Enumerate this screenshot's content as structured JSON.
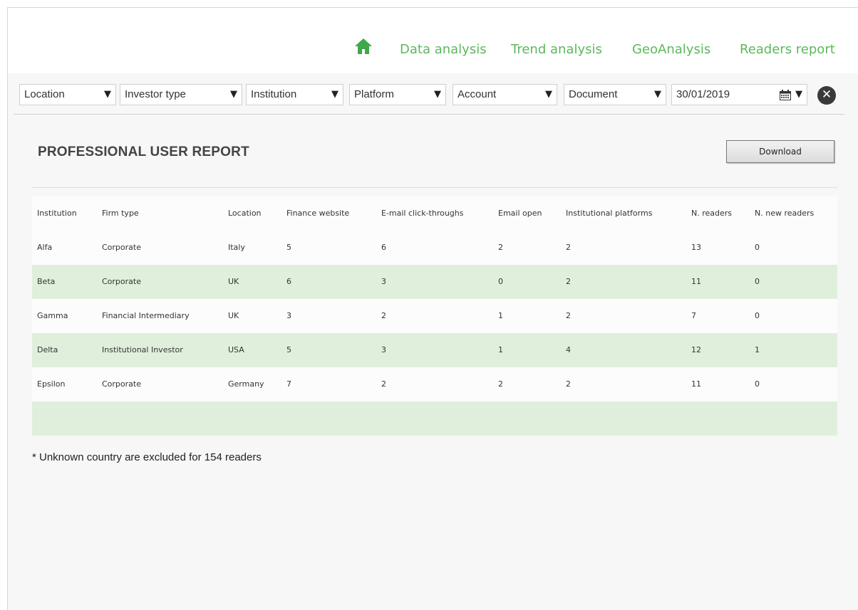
{
  "nav": {
    "items": [
      {
        "label": "Data analysis"
      },
      {
        "label": "Trend analysis"
      },
      {
        "label": "GeoAnalysis"
      },
      {
        "label": "Readers report"
      }
    ],
    "home_icon": "home-icon",
    "accent_color": "#5cb85c"
  },
  "filters": {
    "location": "Location",
    "investor_type": "Investor type",
    "institution": "Institution",
    "platform": "Platform",
    "account": "Account",
    "document": "Document",
    "date": "30/01/2019",
    "calendar_icon": "calendar-icon",
    "clear_icon": "close-icon"
  },
  "report": {
    "title": "PROFESSIONAL USER REPORT",
    "download_label": "Download",
    "footnote": "* Unknown country are excluded for 154 readers"
  },
  "table": {
    "columns": [
      "Institution",
      "Firm type",
      "Location",
      "Finance website",
      "E-mail click-throughs",
      "Email open",
      "Institutional platforms",
      "N. readers",
      "N. new readers"
    ],
    "rows": [
      [
        "Alfa",
        "Corporate",
        "Italy",
        "5",
        "6",
        "2",
        "2",
        "13",
        "0"
      ],
      [
        "Beta",
        "Corporate",
        "UK",
        "6",
        "3",
        "0",
        "2",
        "11",
        "0"
      ],
      [
        "Gamma",
        "Financial Intermediary",
        "UK",
        "3",
        "2",
        "1",
        "2",
        "7",
        "0"
      ],
      [
        "Delta",
        "Institutional Investor",
        "USA",
        "5",
        "3",
        "1",
        "4",
        "12",
        "1"
      ],
      [
        "Epsilon",
        "Corporate",
        "Germany",
        "7",
        "2",
        "2",
        "2",
        "11",
        "0"
      ]
    ],
    "alt_row_color": "#e0efdc"
  }
}
